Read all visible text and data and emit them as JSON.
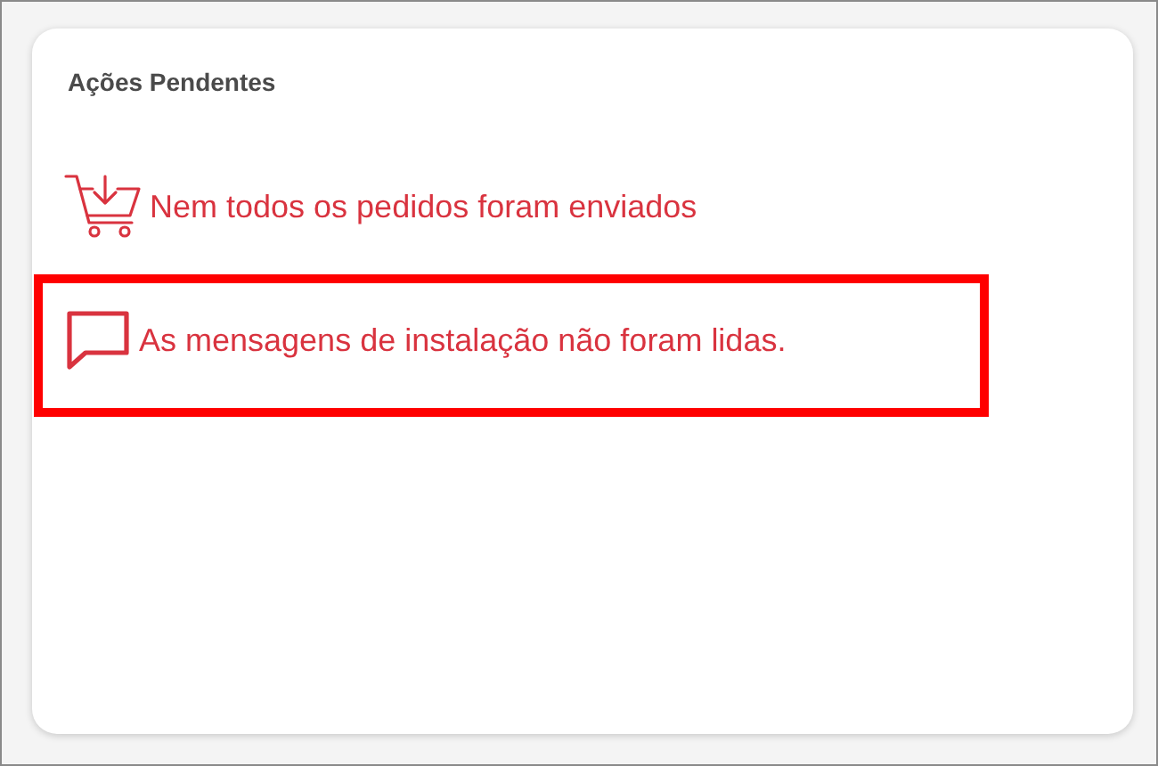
{
  "card": {
    "title": "Ações Pendentes",
    "items": [
      {
        "kind": "cart",
        "text": "Nem todos os pedidos foram enviados",
        "highlighted": false
      },
      {
        "kind": "message",
        "text": "As mensagens de instalação não foram lidas.",
        "highlighted": true
      }
    ]
  }
}
